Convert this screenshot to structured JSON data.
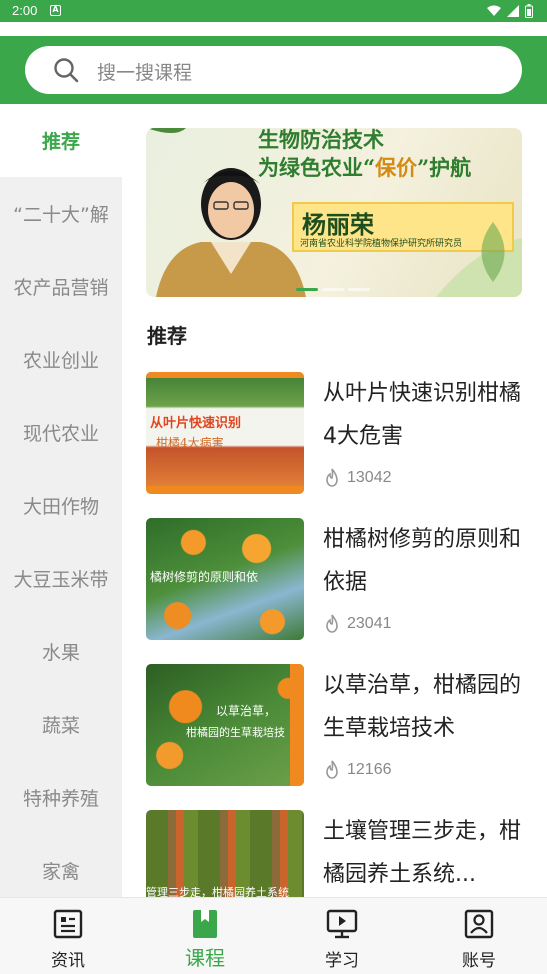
{
  "status_bar": {
    "time": "2:00",
    "notification_badge": "A"
  },
  "search": {
    "placeholder": "搜一搜课程"
  },
  "sidebar": {
    "items": [
      {
        "label": "推荐",
        "active": true
      },
      {
        "label": "“二十大”解",
        "active": false
      },
      {
        "label": "农产品营销",
        "active": false
      },
      {
        "label": "农业创业",
        "active": false
      },
      {
        "label": "现代农业",
        "active": false
      },
      {
        "label": "大田作物",
        "active": false
      },
      {
        "label": "大豆玉米带",
        "active": false
      },
      {
        "label": "水果",
        "active": false
      },
      {
        "label": "蔬菜",
        "active": false
      },
      {
        "label": "特种养殖",
        "active": false
      },
      {
        "label": "家禽",
        "active": false
      }
    ]
  },
  "banner": {
    "line1": "生物防治技术",
    "line2_prefix": "为绿色农业“",
    "line2_highlight": "保价",
    "line2_suffix": "”护航",
    "speaker_name": "杨丽荣",
    "speaker_org": "河南省农业科学院植物保护研究所研究员"
  },
  "section": {
    "title": "推荐"
  },
  "courses": [
    {
      "title": "从叶片快速识别柑橘4大危害",
      "views": "13042",
      "thumb_caption_1": "从叶片快速识别",
      "thumb_caption_2": "柑橘4大病害"
    },
    {
      "title": "柑橘树修剪的原则和依据",
      "views": "23041",
      "thumb_caption_1": "橘树修剪的原则和依"
    },
    {
      "title": "以草治草，柑橘园的生草栽培技术",
      "views": "12166",
      "thumb_caption_1": "以草治草，",
      "thumb_caption_2": "柑橘园的生草栽培技"
    },
    {
      "title": "土壤管理三步走，柑橘园养土系统...",
      "views": "",
      "thumb_caption_1": "管理三步走，柑橘园养土系统"
    }
  ],
  "bottom_nav": [
    {
      "label": "资讯",
      "icon": "news-icon",
      "active": false
    },
    {
      "label": "课程",
      "icon": "course-icon",
      "active": true
    },
    {
      "label": "学习",
      "icon": "study-icon",
      "active": false
    },
    {
      "label": "账号",
      "icon": "account-icon",
      "active": false
    }
  ],
  "colors": {
    "accent": "#3aa84a",
    "sidebar_bg": "#f0f0f0",
    "text_muted": "#888888"
  }
}
